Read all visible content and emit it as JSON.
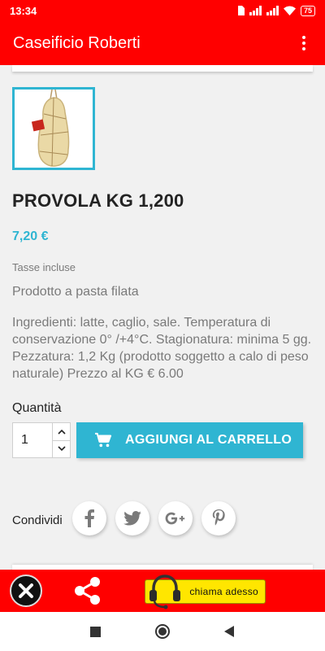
{
  "status_bar": {
    "time": "13:34",
    "battery": "75",
    "icons": [
      "sim-icon",
      "signal-icon",
      "signal-icon",
      "wifi-icon",
      "battery-icon"
    ]
  },
  "app_bar": {
    "title": "Caseificio Roberti",
    "menu_icon": "more-vertical-icon"
  },
  "product": {
    "title": "PROVOLA KG 1,200",
    "price": "7,20 €",
    "tax_note": "Tasse incluse",
    "short_description": "Prodotto a pasta filata",
    "description": "Ingredienti: latte, caglio, sale. Temperatura di conservazione 0° /+4°C. Stagionatura: minima 5 gg. Pezzatura: 1,2 Kg (prodotto soggetto a calo di peso naturale) Prezzo al KG € 6.00"
  },
  "quantity": {
    "label": "Quantità",
    "value": "1"
  },
  "cart": {
    "button_label": "AGGIUNGI AL CARRELLO",
    "icon": "shopping-cart-icon"
  },
  "share": {
    "label": "Condividi",
    "networks": [
      "facebook-icon",
      "twitter-icon",
      "google-plus-icon",
      "pinterest-icon"
    ]
  },
  "bottom_bar": {
    "call_label": "chiama adesso",
    "icons": [
      "close-icon",
      "share-icon",
      "headset-icon"
    ]
  },
  "colors": {
    "brand_red": "#ff0000",
    "accent_blue": "#2fb5d2",
    "call_yellow": "#ffe600"
  }
}
